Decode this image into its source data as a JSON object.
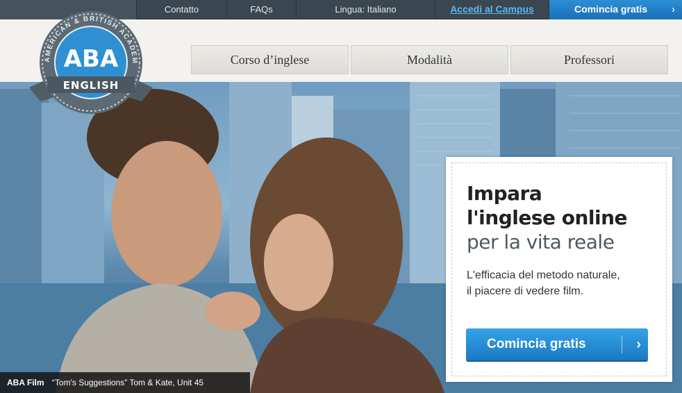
{
  "topbar": {
    "contatto": "Contatto",
    "faqs": "FAQs",
    "lingua": "Lingua: Italiano",
    "campus": "Accedi al Campus",
    "start": "Comincia gratis",
    "start_chevron": "›"
  },
  "logo": {
    "ring_text": "AMERICAN & BRITISH ACADEMY",
    "abbr": "ABA",
    "word": "ENGLISH"
  },
  "nav": {
    "items": [
      {
        "label": "Corso d’inglese"
      },
      {
        "label": "Modalità"
      },
      {
        "label": "Professori"
      }
    ]
  },
  "hero": {
    "caption_film": "ABA Film",
    "caption_text": "“Tom's Suggestions”  Tom & Kate, Unit 45"
  },
  "promo": {
    "line1": "Impara",
    "line2": "l'inglese online",
    "line3": "per la vita reale",
    "body1": "L'efficacia del metodo naturale,",
    "body2": "il piacere di vedere film.",
    "cta": "Comincia gratis",
    "cta_chevron": "›"
  },
  "colors": {
    "topbar": "#3a4750",
    "accent_blue": "#1a79c4",
    "link_blue": "#5fb7f0"
  }
}
